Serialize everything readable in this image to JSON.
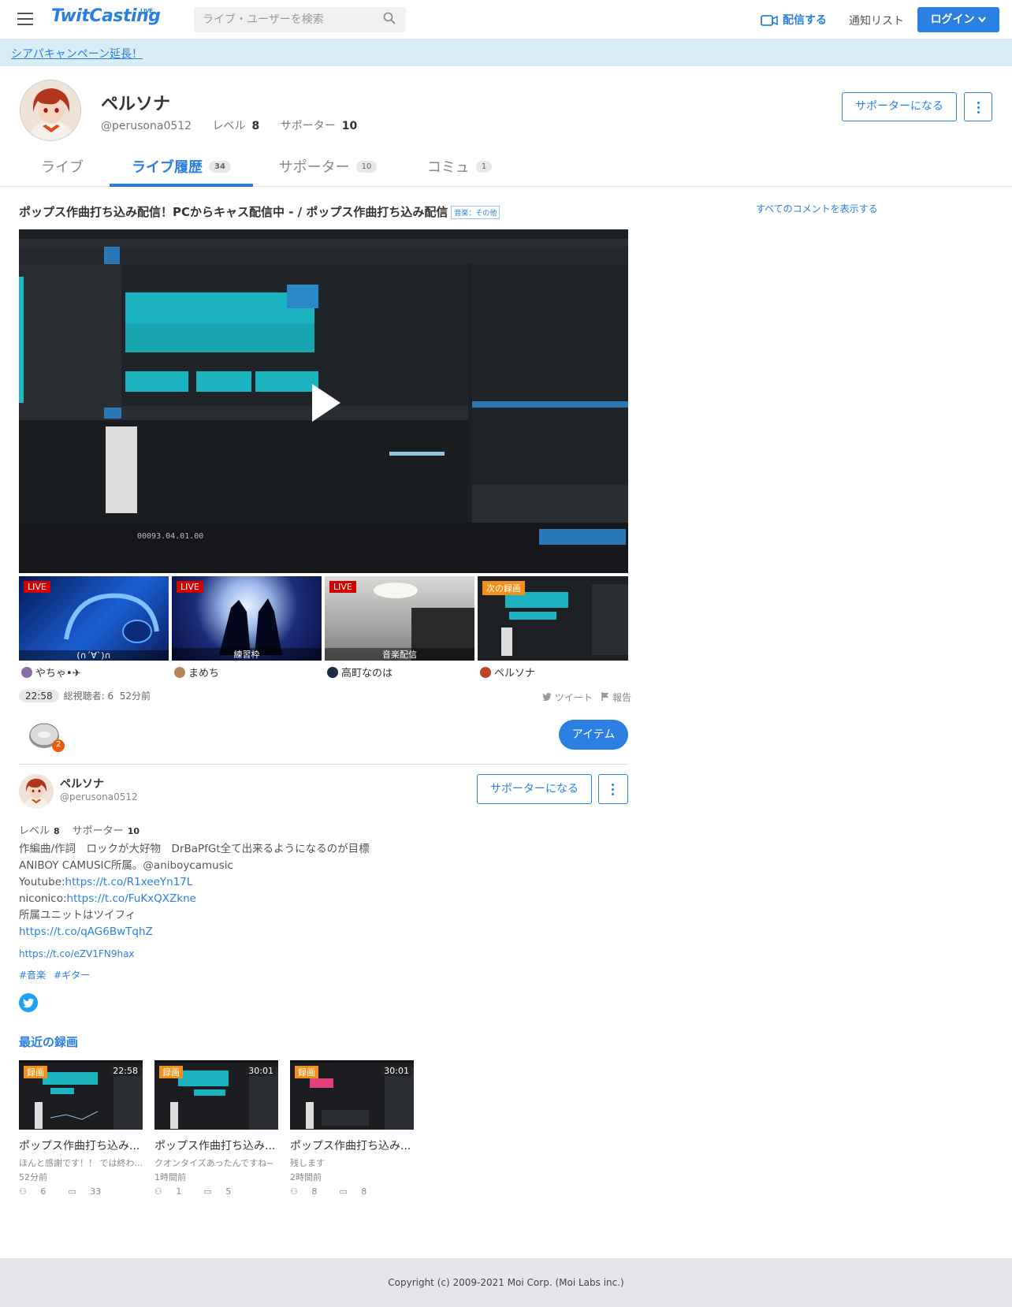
{
  "header": {
    "logo": "TwitCasting",
    "logo_sup": "LIVE",
    "search_placeholder": "ライブ・ユーザーを検索",
    "broadcast": "配信する",
    "notify": "通知リスト",
    "login": "ログイン"
  },
  "banner": {
    "text": "シアパキャンペーン延長！"
  },
  "profile": {
    "name": "ペルソナ",
    "handle": "@perusona0512",
    "level_label": "レベル",
    "level": "8",
    "supporter_label": "サポーター",
    "supporters": "10",
    "supporter_button": "サポーターになる"
  },
  "tabs": [
    {
      "label": "ライブ",
      "count": ""
    },
    {
      "label": "ライブ履歴",
      "count": "34"
    },
    {
      "label": "サポーター",
      "count": "10"
    },
    {
      "label": "コミュ",
      "count": "1"
    }
  ],
  "movie": {
    "title": "ポップス作曲打ち込み配信！PCからキャス配信中 - / ポップス作曲打ち込み配信",
    "category": "音楽：その他",
    "all_comments": "すべてのコメントを表示する"
  },
  "related": [
    {
      "badge": "LIVE",
      "caption": "(∩´∀`)∩",
      "user": "やちゃ•✈"
    },
    {
      "badge": "LIVE",
      "caption": "練習枠",
      "user": "まめち"
    },
    {
      "badge": "LIVE",
      "caption": "音楽配信",
      "user": "高町なのは"
    },
    {
      "badge": "次の録画",
      "caption": "",
      "user": "ペルソナ"
    }
  ],
  "stats": {
    "duration": "22:58",
    "viewers": "総視聴者: 6",
    "ago": "52分前",
    "tweet": "ツイート",
    "report": "報告",
    "coin_count": "2",
    "item_button": "アイテム"
  },
  "bio": {
    "lines": [
      "作編曲/作詞　ロックが大好物　DrBaPfGt全て出来るようになるのが目標",
      "ANIBOY CAMUSIC所属。@aniboycamusic"
    ],
    "youtube_label": "Youtube:",
    "youtube_url": "https://t.co/R1xeeYn17L",
    "niconico_label": "niconico:",
    "niconico_url": "https://t.co/FuKxQXZkne",
    "unit_line": "所属ユニットはツイフィ",
    "unit_url": "https://t.co/qAG6BwTqhZ",
    "url": "https://t.co/eZV1FN9hax",
    "tags": [
      "#音楽",
      "#ギター"
    ]
  },
  "recent": {
    "heading": "最近の録画",
    "items": [
      {
        "badge": "録画",
        "duration": "22:58",
        "title": "ポップス作曲打ち込み...",
        "comment": "ほんと感謝です！！ では終わ...",
        "ago": "52分前",
        "viewers": "6",
        "comments": "33"
      },
      {
        "badge": "録画",
        "duration": "30:01",
        "title": "ポップス作曲打ち込み...",
        "comment": "クオンタイズあったんですね~",
        "ago": "1時間前",
        "viewers": "1",
        "comments": "5"
      },
      {
        "badge": "録画",
        "duration": "30:01",
        "title": "ポップス作曲打ち込み...",
        "comment": "残します",
        "ago": "2時間前",
        "viewers": "8",
        "comments": "8"
      }
    ]
  },
  "footer": {
    "copyright": "Copyright (c) 2009-2021 Moi Corp. (Moi Labs inc.)"
  },
  "colors": {
    "accent": "#2a7fe0",
    "live": "#d40000",
    "recording": "#f29019",
    "banner": "#d9edf6"
  }
}
